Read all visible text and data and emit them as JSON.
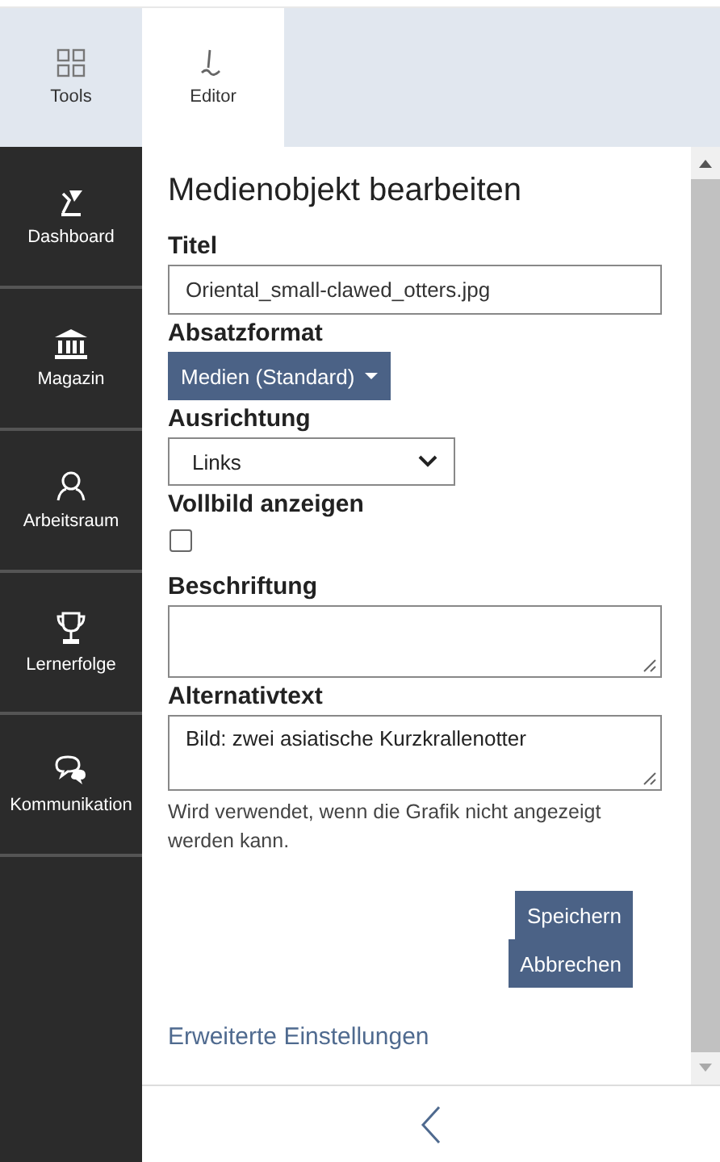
{
  "tabs": [
    {
      "label": "Tools",
      "selected": false
    },
    {
      "label": "Editor",
      "selected": true
    }
  ],
  "sidebar": {
    "items": [
      {
        "label": "Dashboard"
      },
      {
        "label": "Magazin"
      },
      {
        "label": "Arbeitsraum"
      },
      {
        "label": "Lernerfolge"
      },
      {
        "label": "Kommunikation"
      }
    ]
  },
  "form": {
    "title": "Medienobjekt bearbeiten",
    "fields": [
      {
        "kind": "text",
        "label": "Titel",
        "value": "Oriental_small-clawed_otters.jpg"
      },
      {
        "kind": "dropdown",
        "label": "Absatzformat",
        "value": "Medien (Standard)"
      },
      {
        "kind": "select",
        "label": "Ausrichtung",
        "value": "Links"
      },
      {
        "kind": "checkbox",
        "label": "Vollbild anzeigen",
        "checked": false
      },
      {
        "kind": "textarea",
        "label": "Beschriftung"
      },
      {
        "kind": "textarea",
        "label": "Alternativtext",
        "value": "Bild: zwei asiatische Kurzkrallenotter",
        "note": "Wird verwendet, wenn die Grafik nicht angezeigt werden kann."
      }
    ],
    "buttons": [
      "Speichern",
      "Abbrechen"
    ],
    "link": "Erweiterte Einstellungen"
  }
}
